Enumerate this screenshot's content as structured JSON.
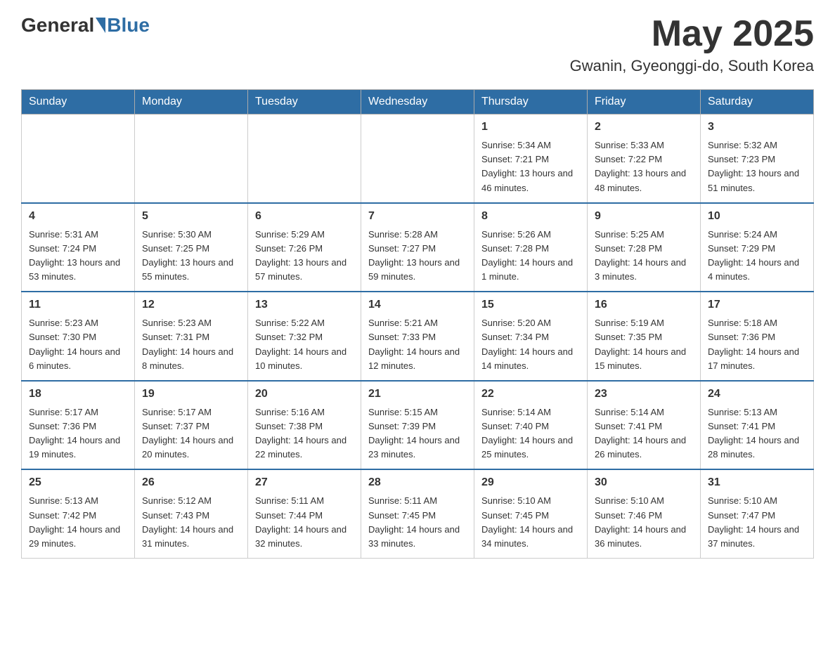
{
  "header": {
    "logo_general": "General",
    "logo_blue": "Blue",
    "month_title": "May 2025",
    "location": "Gwanin, Gyeonggi-do, South Korea"
  },
  "weekdays": [
    "Sunday",
    "Monday",
    "Tuesday",
    "Wednesday",
    "Thursday",
    "Friday",
    "Saturday"
  ],
  "weeks": [
    [
      {
        "day": "",
        "sunrise": "",
        "sunset": "",
        "daylight": ""
      },
      {
        "day": "",
        "sunrise": "",
        "sunset": "",
        "daylight": ""
      },
      {
        "day": "",
        "sunrise": "",
        "sunset": "",
        "daylight": ""
      },
      {
        "day": "",
        "sunrise": "",
        "sunset": "",
        "daylight": ""
      },
      {
        "day": "1",
        "sunrise": "Sunrise: 5:34 AM",
        "sunset": "Sunset: 7:21 PM",
        "daylight": "Daylight: 13 hours and 46 minutes."
      },
      {
        "day": "2",
        "sunrise": "Sunrise: 5:33 AM",
        "sunset": "Sunset: 7:22 PM",
        "daylight": "Daylight: 13 hours and 48 minutes."
      },
      {
        "day": "3",
        "sunrise": "Sunrise: 5:32 AM",
        "sunset": "Sunset: 7:23 PM",
        "daylight": "Daylight: 13 hours and 51 minutes."
      }
    ],
    [
      {
        "day": "4",
        "sunrise": "Sunrise: 5:31 AM",
        "sunset": "Sunset: 7:24 PM",
        "daylight": "Daylight: 13 hours and 53 minutes."
      },
      {
        "day": "5",
        "sunrise": "Sunrise: 5:30 AM",
        "sunset": "Sunset: 7:25 PM",
        "daylight": "Daylight: 13 hours and 55 minutes."
      },
      {
        "day": "6",
        "sunrise": "Sunrise: 5:29 AM",
        "sunset": "Sunset: 7:26 PM",
        "daylight": "Daylight: 13 hours and 57 minutes."
      },
      {
        "day": "7",
        "sunrise": "Sunrise: 5:28 AM",
        "sunset": "Sunset: 7:27 PM",
        "daylight": "Daylight: 13 hours and 59 minutes."
      },
      {
        "day": "8",
        "sunrise": "Sunrise: 5:26 AM",
        "sunset": "Sunset: 7:28 PM",
        "daylight": "Daylight: 14 hours and 1 minute."
      },
      {
        "day": "9",
        "sunrise": "Sunrise: 5:25 AM",
        "sunset": "Sunset: 7:28 PM",
        "daylight": "Daylight: 14 hours and 3 minutes."
      },
      {
        "day": "10",
        "sunrise": "Sunrise: 5:24 AM",
        "sunset": "Sunset: 7:29 PM",
        "daylight": "Daylight: 14 hours and 4 minutes."
      }
    ],
    [
      {
        "day": "11",
        "sunrise": "Sunrise: 5:23 AM",
        "sunset": "Sunset: 7:30 PM",
        "daylight": "Daylight: 14 hours and 6 minutes."
      },
      {
        "day": "12",
        "sunrise": "Sunrise: 5:23 AM",
        "sunset": "Sunset: 7:31 PM",
        "daylight": "Daylight: 14 hours and 8 minutes."
      },
      {
        "day": "13",
        "sunrise": "Sunrise: 5:22 AM",
        "sunset": "Sunset: 7:32 PM",
        "daylight": "Daylight: 14 hours and 10 minutes."
      },
      {
        "day": "14",
        "sunrise": "Sunrise: 5:21 AM",
        "sunset": "Sunset: 7:33 PM",
        "daylight": "Daylight: 14 hours and 12 minutes."
      },
      {
        "day": "15",
        "sunrise": "Sunrise: 5:20 AM",
        "sunset": "Sunset: 7:34 PM",
        "daylight": "Daylight: 14 hours and 14 minutes."
      },
      {
        "day": "16",
        "sunrise": "Sunrise: 5:19 AM",
        "sunset": "Sunset: 7:35 PM",
        "daylight": "Daylight: 14 hours and 15 minutes."
      },
      {
        "day": "17",
        "sunrise": "Sunrise: 5:18 AM",
        "sunset": "Sunset: 7:36 PM",
        "daylight": "Daylight: 14 hours and 17 minutes."
      }
    ],
    [
      {
        "day": "18",
        "sunrise": "Sunrise: 5:17 AM",
        "sunset": "Sunset: 7:36 PM",
        "daylight": "Daylight: 14 hours and 19 minutes."
      },
      {
        "day": "19",
        "sunrise": "Sunrise: 5:17 AM",
        "sunset": "Sunset: 7:37 PM",
        "daylight": "Daylight: 14 hours and 20 minutes."
      },
      {
        "day": "20",
        "sunrise": "Sunrise: 5:16 AM",
        "sunset": "Sunset: 7:38 PM",
        "daylight": "Daylight: 14 hours and 22 minutes."
      },
      {
        "day": "21",
        "sunrise": "Sunrise: 5:15 AM",
        "sunset": "Sunset: 7:39 PM",
        "daylight": "Daylight: 14 hours and 23 minutes."
      },
      {
        "day": "22",
        "sunrise": "Sunrise: 5:14 AM",
        "sunset": "Sunset: 7:40 PM",
        "daylight": "Daylight: 14 hours and 25 minutes."
      },
      {
        "day": "23",
        "sunrise": "Sunrise: 5:14 AM",
        "sunset": "Sunset: 7:41 PM",
        "daylight": "Daylight: 14 hours and 26 minutes."
      },
      {
        "day": "24",
        "sunrise": "Sunrise: 5:13 AM",
        "sunset": "Sunset: 7:41 PM",
        "daylight": "Daylight: 14 hours and 28 minutes."
      }
    ],
    [
      {
        "day": "25",
        "sunrise": "Sunrise: 5:13 AM",
        "sunset": "Sunset: 7:42 PM",
        "daylight": "Daylight: 14 hours and 29 minutes."
      },
      {
        "day": "26",
        "sunrise": "Sunrise: 5:12 AM",
        "sunset": "Sunset: 7:43 PM",
        "daylight": "Daylight: 14 hours and 31 minutes."
      },
      {
        "day": "27",
        "sunrise": "Sunrise: 5:11 AM",
        "sunset": "Sunset: 7:44 PM",
        "daylight": "Daylight: 14 hours and 32 minutes."
      },
      {
        "day": "28",
        "sunrise": "Sunrise: 5:11 AM",
        "sunset": "Sunset: 7:45 PM",
        "daylight": "Daylight: 14 hours and 33 minutes."
      },
      {
        "day": "29",
        "sunrise": "Sunrise: 5:10 AM",
        "sunset": "Sunset: 7:45 PM",
        "daylight": "Daylight: 14 hours and 34 minutes."
      },
      {
        "day": "30",
        "sunrise": "Sunrise: 5:10 AM",
        "sunset": "Sunset: 7:46 PM",
        "daylight": "Daylight: 14 hours and 36 minutes."
      },
      {
        "day": "31",
        "sunrise": "Sunrise: 5:10 AM",
        "sunset": "Sunset: 7:47 PM",
        "daylight": "Daylight: 14 hours and 37 minutes."
      }
    ]
  ]
}
